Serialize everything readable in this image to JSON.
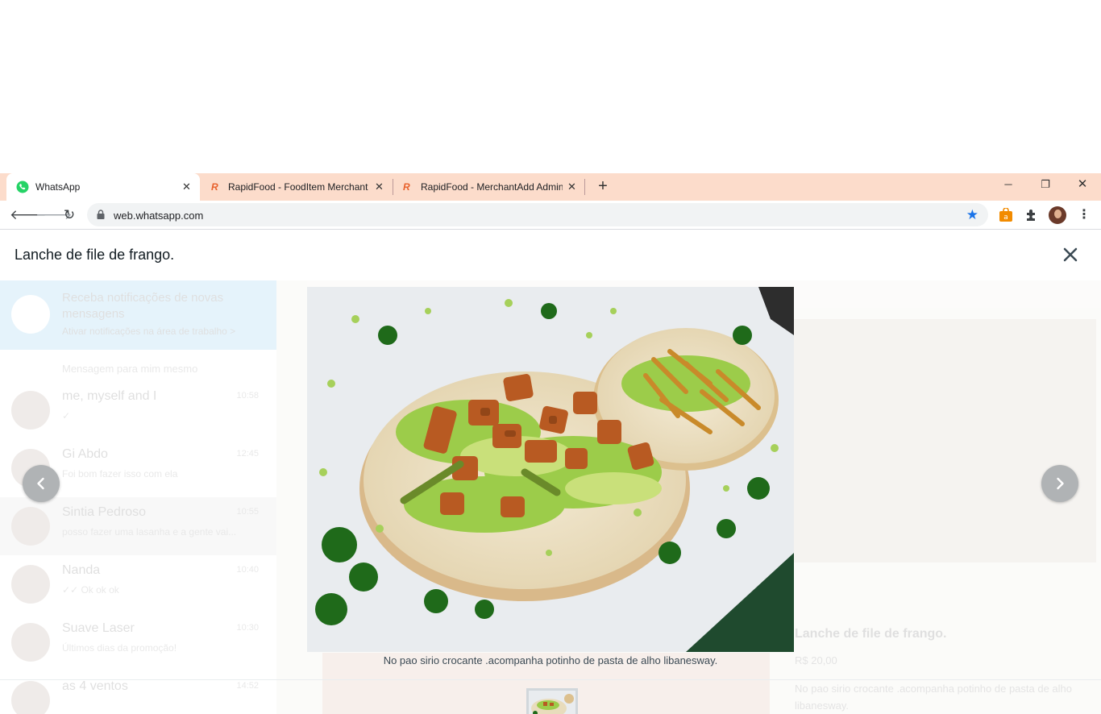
{
  "browser": {
    "tabs": [
      {
        "title": "WhatsApp",
        "active": true
      },
      {
        "title": "RapidFood - FoodItem Merchant",
        "active": false
      },
      {
        "title": "RapidFood - MerchantAdd Admin",
        "active": false
      }
    ],
    "url": "web.whatsapp.com",
    "colors": {
      "tabbar": "#fcdccb",
      "bookmark_star": "#1a73e8"
    }
  },
  "viewer": {
    "title": "Lanche de file de frango.",
    "caption": "No pao sirio crocante .acompanha potinho de pasta de alho libanesway."
  },
  "background": {
    "notify_title": "Receba notificações de novas mensagens",
    "notify_sub": "Ativar notificações na área de trabalho >",
    "pin_text": "Mensagem para mim mesmo",
    "chats": [
      {
        "name": "me, myself and I",
        "message": "✓",
        "time": "10:58"
      },
      {
        "name": "Gi Abdo",
        "message": "Foi bom fazer isso com ela",
        "time": "12:45"
      },
      {
        "name": "Sintia Pedroso",
        "message": "posso fazer uma lasanha e a gente vai...",
        "time": "10:55"
      },
      {
        "name": "Nanda",
        "message": "✓✓ Ok ok ok",
        "time": "10:40"
      },
      {
        "name": "Suave Laser",
        "message": "Últimos dias da promoção!",
        "time": "10:30"
      },
      {
        "name": "as 4 ventos",
        "message": "",
        "time": "14:52"
      }
    ],
    "product_title": "Lanche de file de frango.",
    "product_price": "R$ 20,00",
    "product_desc": "No pao sirio crocante .acompanha potinho de pasta de alho libanesway."
  }
}
